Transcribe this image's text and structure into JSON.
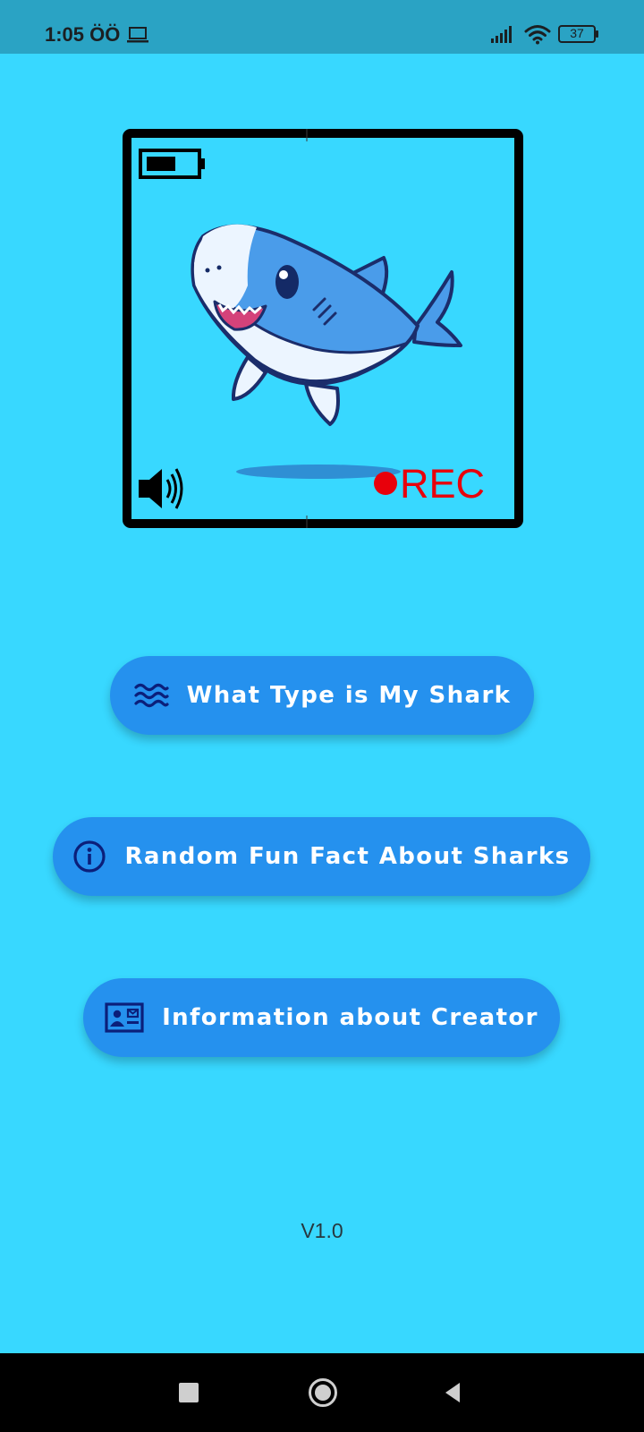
{
  "status_bar": {
    "time": "1:05 ÖÖ",
    "battery_level": "37",
    "icons": [
      "laptop-icon",
      "signal-icon",
      "wifi-icon",
      "battery-icon"
    ]
  },
  "hero": {
    "rec_label": "REC",
    "icons": [
      "battery-icon",
      "shark-illustration",
      "speaker-icon",
      "record-dot-icon"
    ]
  },
  "menu": {
    "buttons": [
      {
        "label": "What Type is My Shark",
        "icon": "waves-icon"
      },
      {
        "label": "Random Fun Fact About Sharks",
        "icon": "info-icon"
      },
      {
        "label": "Information about Creator",
        "icon": "contact-card-icon"
      }
    ]
  },
  "footer": {
    "version": "V1.0"
  },
  "colors": {
    "background": "#38d8ff",
    "status_bar": "#2aa3c4",
    "button": "#2591ee",
    "icon_navy": "#0b1f7a",
    "rec_red": "#e8000b"
  }
}
